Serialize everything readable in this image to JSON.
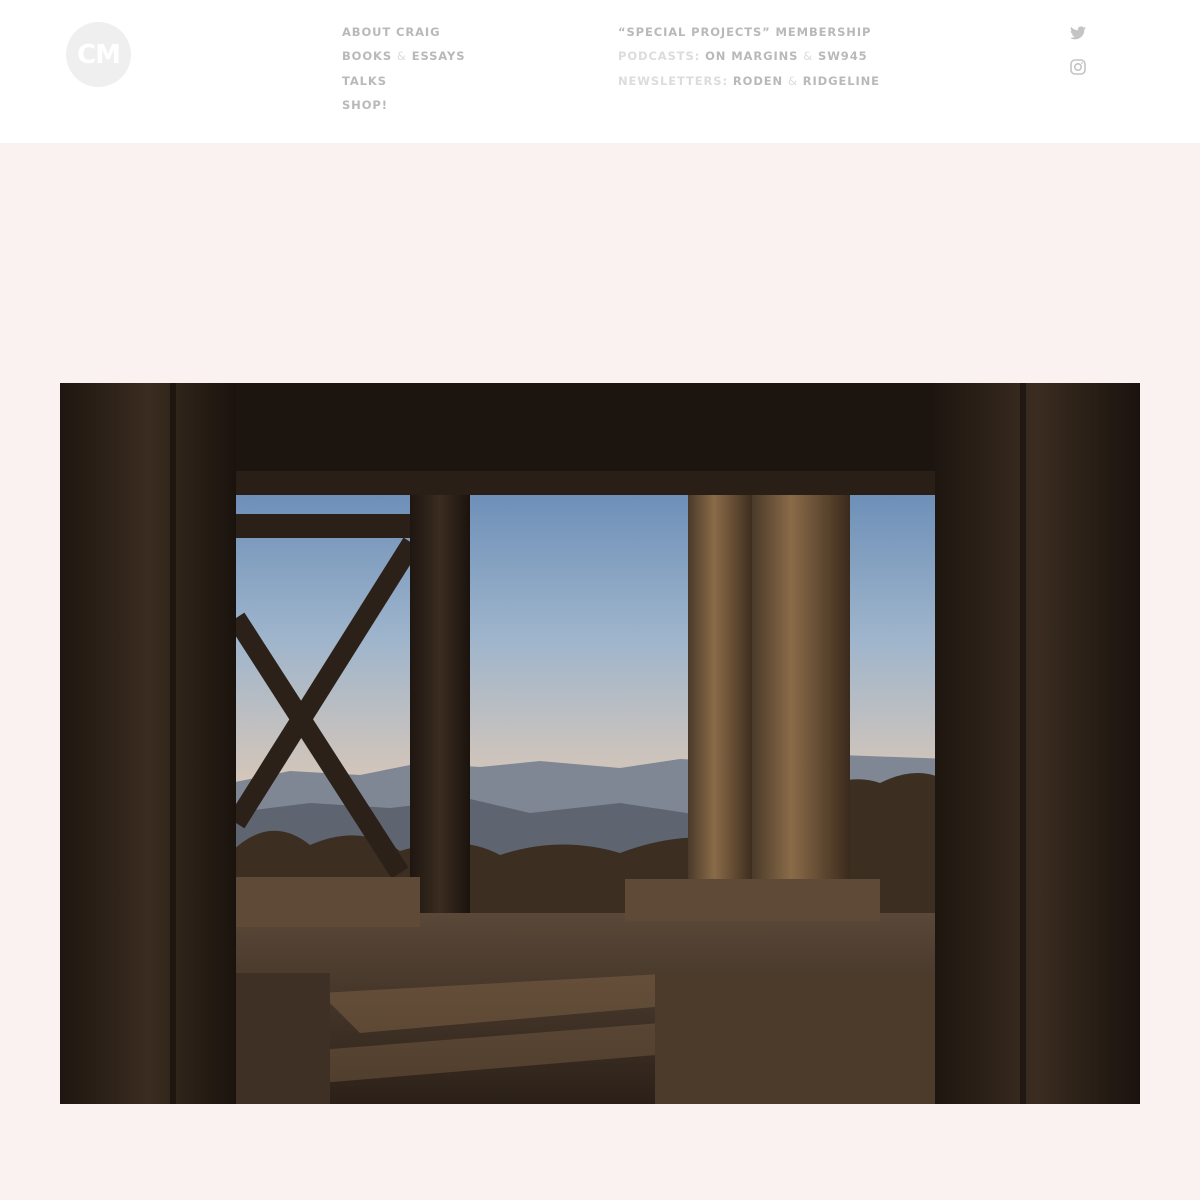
{
  "logo": {
    "text": "CM"
  },
  "nav_left": [
    {
      "label": "ABOUT CRAIG"
    },
    {
      "label": "BOOKS",
      "amp": "&",
      "label2": "ESSAYS"
    },
    {
      "label": "TALKS"
    },
    {
      "label": "SHOP!"
    }
  ],
  "nav_right": {
    "membership": "“SPECIAL PROJECTS” MEMBERSHIP",
    "podcasts": {
      "prefix": "PODCASTS:",
      "link1": "ON MARGINS",
      "amp": "&",
      "link2": "SW945"
    },
    "newsletters": {
      "prefix": "NEWSLETTERS:",
      "link1": "RODEN",
      "amp": "&",
      "link2": "RIDGELINE"
    }
  },
  "social": {
    "twitter_icon": "twitter-icon",
    "instagram_icon": "instagram-icon"
  },
  "colors": {
    "header_bg": "#ffffff",
    "page_bg": "#faf2f0",
    "nav_text": "#b9b9b9",
    "nav_muted": "#dcdcdc",
    "logo_bg": "#efefef"
  }
}
